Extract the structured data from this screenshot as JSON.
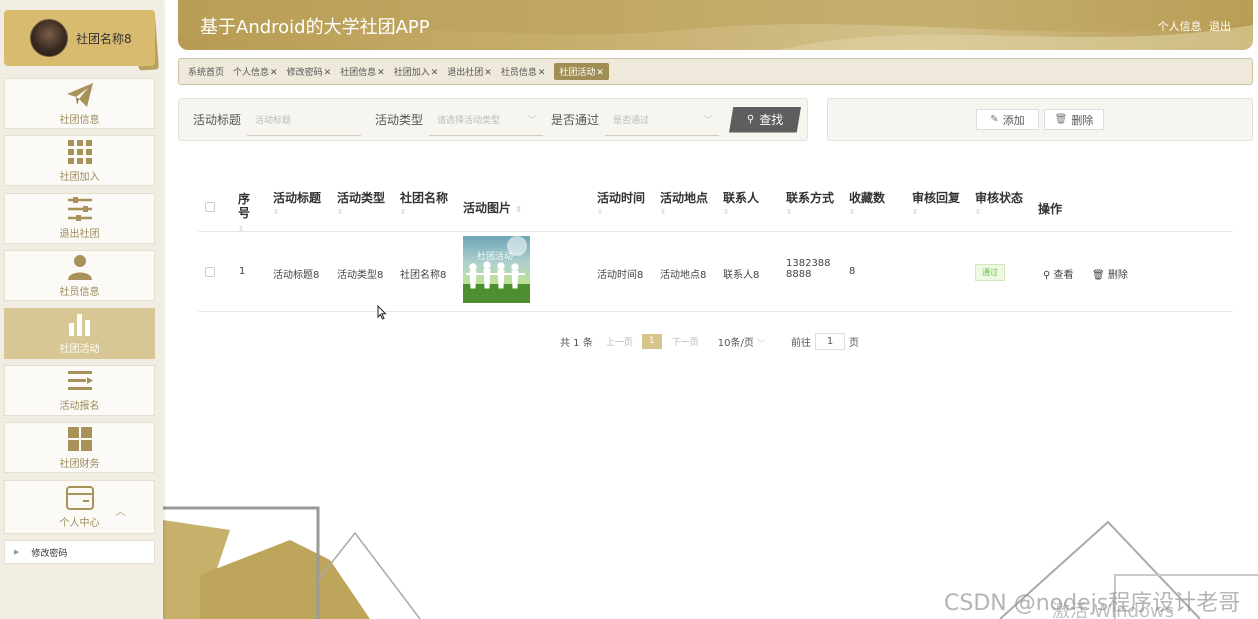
{
  "header": {
    "title": "基于Android的大学社团APP",
    "profile_link": "个人信息",
    "logout_link": "退出"
  },
  "colors": {
    "brand": "#c8b070",
    "active_menu": "#d6c794",
    "active_tab": "#a08e55",
    "success": "#6cbf45"
  },
  "sidebar": {
    "profile_name": "社团名称8",
    "items": [
      {
        "label": "社团信息",
        "icon": "paper-plane-icon"
      },
      {
        "label": "社团加入",
        "icon": "grid-icon"
      },
      {
        "label": "退出社团",
        "icon": "sliders-icon"
      },
      {
        "label": "社员信息",
        "icon": "user-icon"
      },
      {
        "label": "社团活动",
        "icon": "bar-chart-icon",
        "active": true
      },
      {
        "label": "活动报名",
        "icon": "list-icon"
      },
      {
        "label": "社团财务",
        "icon": "dashboard-icon"
      },
      {
        "label": "个人中心",
        "icon": "wallet-icon",
        "expanded": true
      }
    ],
    "submenu": {
      "label": "修改密码"
    }
  },
  "tabs": [
    {
      "label": "系统首页",
      "closable": false
    },
    {
      "label": "个人信息",
      "closable": true
    },
    {
      "label": "修改密码",
      "closable": true
    },
    {
      "label": "社团信息",
      "closable": true
    },
    {
      "label": "社团加入",
      "closable": true
    },
    {
      "label": "退出社团",
      "closable": true
    },
    {
      "label": "社员信息",
      "closable": true
    },
    {
      "label": "社团活动",
      "closable": true,
      "active": true
    }
  ],
  "search": {
    "title_label": "活动标题",
    "title_placeholder": "活动标题",
    "type_label": "活动类型",
    "type_placeholder": "请选择活动类型",
    "pass_label": "是否通过",
    "pass_placeholder": "是否通过",
    "button": "查找"
  },
  "actions": {
    "add": "添加",
    "delete": "删除"
  },
  "table": {
    "headers": {
      "index": "序号",
      "title": "活动标题",
      "type": "活动类型",
      "club": "社团名称",
      "image": "活动图片",
      "time": "活动时间",
      "place": "活动地点",
      "contact": "联系人",
      "phone": "联系方式",
      "favorites": "收藏数",
      "reply": "审核回复",
      "status": "审核状态",
      "ops": "操作"
    },
    "rows": [
      {
        "index": "1",
        "title": "活动标题8",
        "type": "活动类型8",
        "club": "社团名称8",
        "image_caption": "社团活动",
        "time": "活动时间8",
        "place": "活动地点8",
        "contact": "联系人8",
        "phone_line1": "1382388",
        "phone_line2": "8888",
        "favorites": "8",
        "reply": "",
        "status": "通过",
        "view": "查看",
        "delete": "删除"
      }
    ]
  },
  "pagination": {
    "total": "共 1 条",
    "prev": "上一页",
    "current": "1",
    "next": "下一页",
    "page_size": "10条/页",
    "goto": "前往",
    "goto_value": "1",
    "page_unit": "页"
  },
  "watermarks": {
    "csdn": "CSDN @nodejs程序设计老哥",
    "windows": "激活 Windows"
  }
}
